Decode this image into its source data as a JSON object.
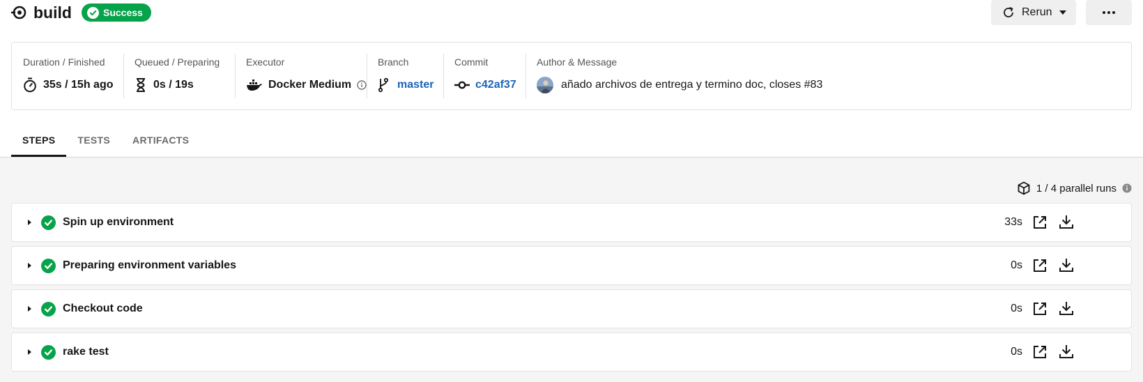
{
  "header": {
    "title": "build",
    "status": "Success",
    "rerun_label": "Rerun"
  },
  "meta": {
    "duration": {
      "label": "Duration / Finished",
      "value": "35s / 15h ago"
    },
    "queued": {
      "label": "Queued / Preparing",
      "value": "0s / 19s"
    },
    "executor": {
      "label": "Executor",
      "value": "Docker Medium"
    },
    "branch": {
      "label": "Branch",
      "value": "master"
    },
    "commit": {
      "label": "Commit",
      "value": "c42af37"
    },
    "author": {
      "label": "Author & Message",
      "value": "añado archivos de entrega y termino doc, closes #83"
    }
  },
  "tabs": [
    {
      "label": "STEPS",
      "active": true
    },
    {
      "label": "TESTS",
      "active": false
    },
    {
      "label": "ARTIFACTS",
      "active": false
    }
  ],
  "parallel_runs": "1 / 4 parallel runs",
  "steps": [
    {
      "name": "Spin up environment",
      "duration": "33s"
    },
    {
      "name": "Preparing environment variables",
      "duration": "0s"
    },
    {
      "name": "Checkout code",
      "duration": "0s"
    },
    {
      "name": "rake test",
      "duration": "0s"
    }
  ],
  "colors": {
    "success": "#07a34a",
    "link": "#1b64b8",
    "text": "#161616",
    "panel_bg": "#f5f5f5"
  },
  "icons": {
    "brand": "circleci-logo-icon",
    "duration": "stopwatch-icon",
    "queued": "hourglass-icon",
    "executor": "docker-icon",
    "branch": "git-branch-icon",
    "commit": "git-commit-icon",
    "step_expand": "caret-right-icon",
    "step_status": "check-circle-icon",
    "step_open": "external-link-icon",
    "step_download": "download-icon"
  }
}
